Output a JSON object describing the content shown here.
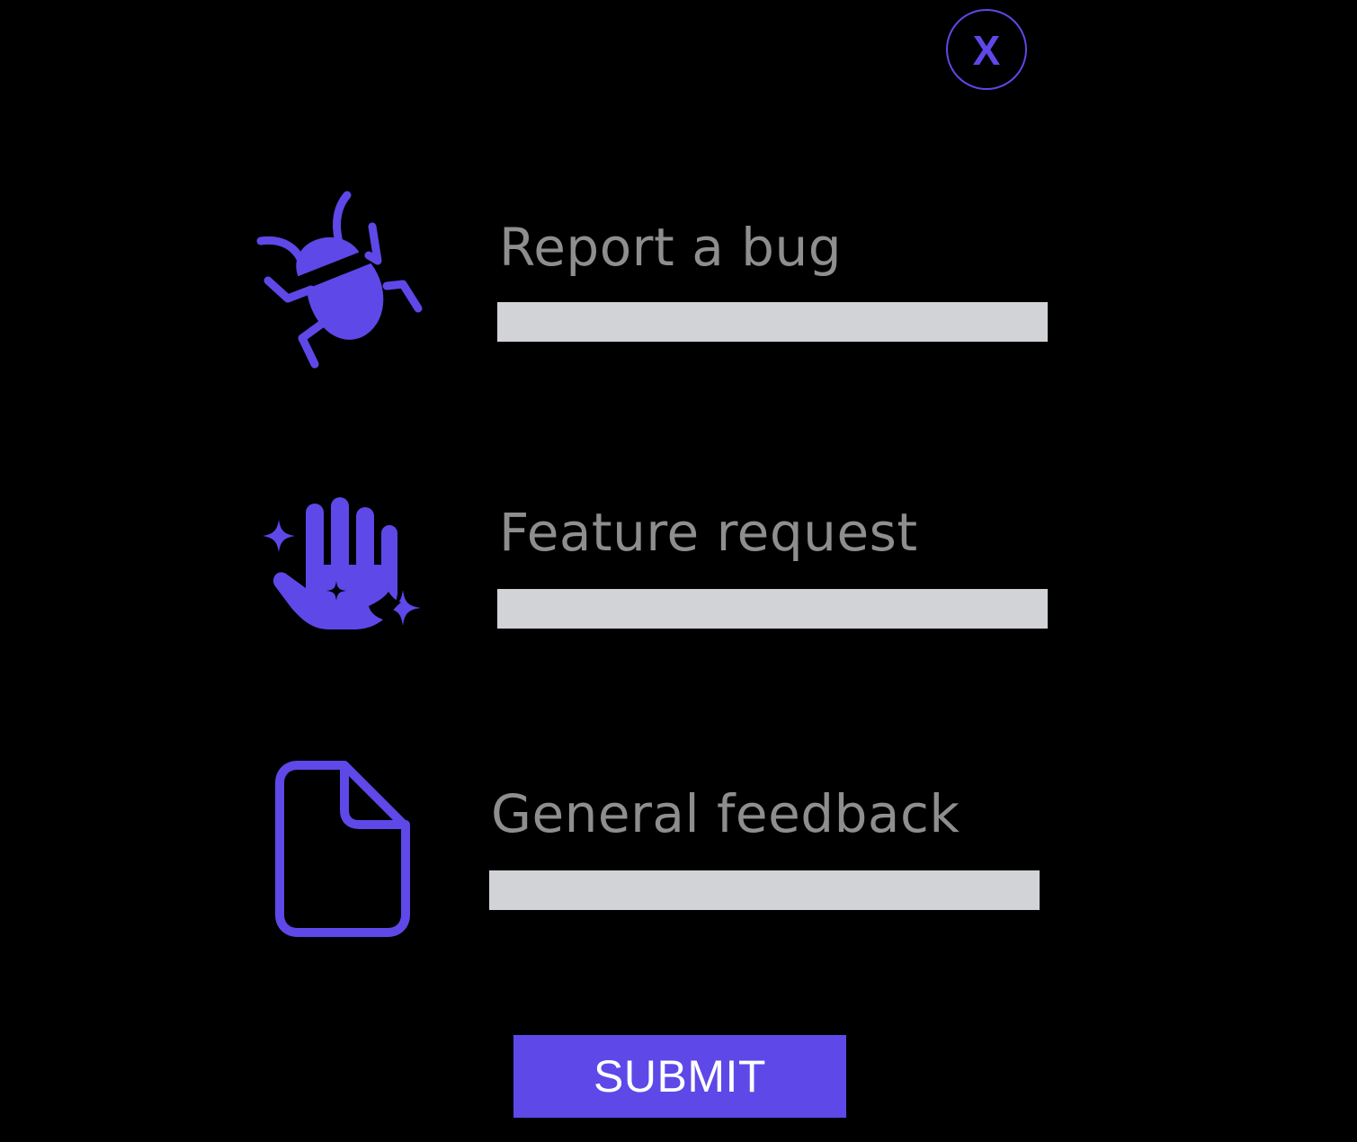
{
  "accent_color": "#5e48e8",
  "field_color": "#d1d3d6",
  "label_color": "#8e8e8e",
  "background_color": "#000000",
  "close": {
    "label": "X",
    "icon": "close-icon"
  },
  "options": [
    {
      "icon": "bug-icon",
      "label": "Report a bug",
      "value": ""
    },
    {
      "icon": "hand-sparkles-icon",
      "label": "Feature request",
      "value": ""
    },
    {
      "icon": "document-icon",
      "label": "General feedback",
      "value": ""
    }
  ],
  "submit": {
    "label": "SUBMIT"
  }
}
